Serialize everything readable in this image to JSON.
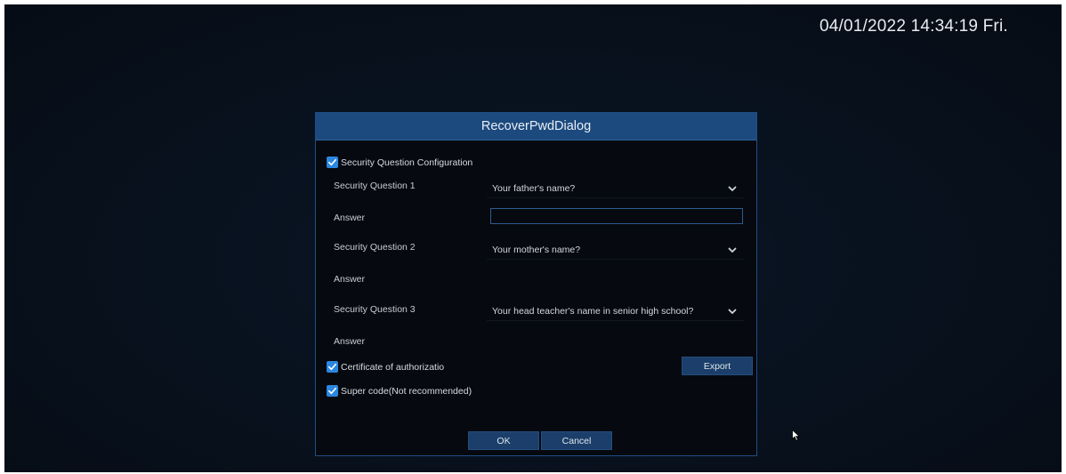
{
  "datetime": "04/01/2022 14:34:19 Fri.",
  "dialog": {
    "title": "RecoverPwdDialog",
    "security_config": {
      "label": "Security Question Configuration",
      "checked": true
    },
    "questions": [
      {
        "label": "Security Question 1",
        "value": "Your father's name?",
        "answer_label": "Answer",
        "answer_value": ""
      },
      {
        "label": "Security Question 2",
        "value": "Your mother's name?",
        "answer_label": "Answer",
        "answer_value": ""
      },
      {
        "label": "Security Question 3",
        "value": "Your head teacher's name in senior high school?",
        "answer_label": "Answer",
        "answer_value": ""
      }
    ],
    "certificate": {
      "label": "Certificate of authorizatio",
      "checked": true
    },
    "export_label": "Export",
    "super_code": {
      "label": "Super code(Not recommended)",
      "checked": true
    },
    "ok_label": "OK",
    "cancel_label": "Cancel"
  },
  "colors": {
    "accent": "#2b86e0",
    "title_bar": "#1c4a7e",
    "button": "#1b3f6a"
  }
}
